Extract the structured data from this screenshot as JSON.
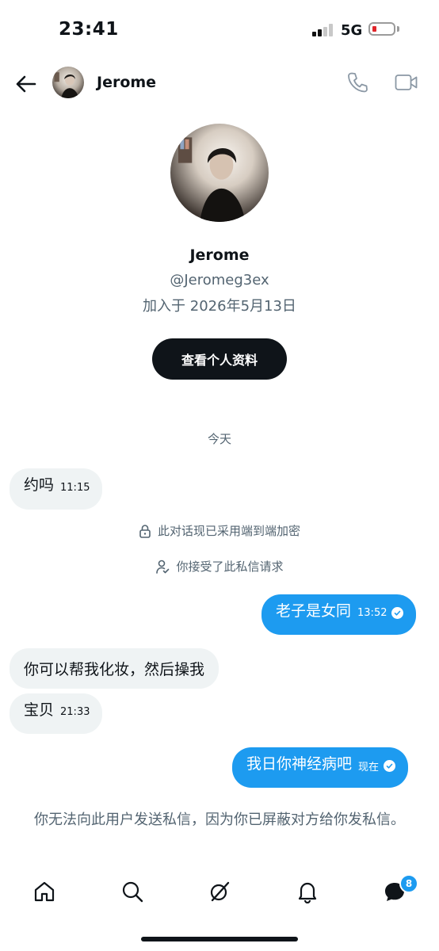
{
  "status_bar": {
    "time": "23:41",
    "network": "5G"
  },
  "header": {
    "name": "Jerome"
  },
  "profile": {
    "name": "Jerome",
    "handle": "@Jeromeg3ex",
    "joined": "加入于 2026年5月13日",
    "view_profile_label": "查看个人资料"
  },
  "conversation": {
    "date_divider": "今天",
    "messages": [
      {
        "dir": "in",
        "text": "约吗",
        "time": "11:15"
      },
      {
        "dir": "out",
        "text": "老子是女同",
        "time": "13:52"
      },
      {
        "dir": "in",
        "text": "你可以帮我化妆，然后操我",
        "time": ""
      },
      {
        "dir": "in",
        "text": "宝贝",
        "time": "21:33"
      },
      {
        "dir": "out",
        "text": "我日你神经病吧",
        "time": "现在"
      }
    ],
    "system_notices": [
      {
        "icon": "lock-icon",
        "text": "此对话现已采用端到端加密"
      },
      {
        "icon": "person-check-icon",
        "text": "你接受了此私信请求"
      }
    ],
    "blocked_notice": "你无法向此用户发送私信，因为你已屏蔽对方给你发私信。"
  },
  "bottom_nav": {
    "items": [
      "home-icon",
      "search-icon",
      "grok-icon",
      "notifications-icon",
      "messages-icon"
    ],
    "messages_badge": "8"
  },
  "colors": {
    "accent": "#1d9bf0",
    "text": "#0f1419",
    "secondary": "#536471",
    "bubble_in": "#eff3f4"
  }
}
